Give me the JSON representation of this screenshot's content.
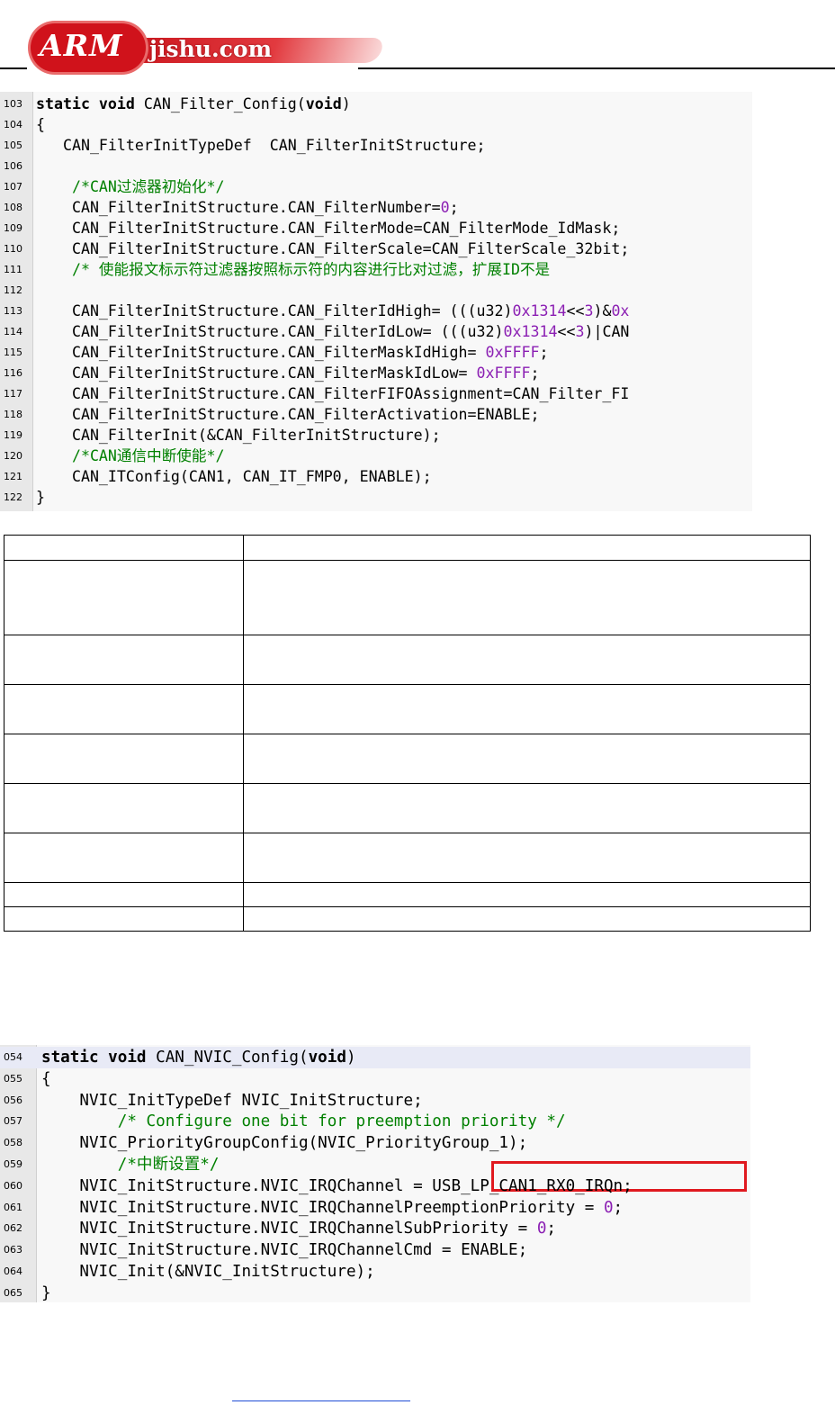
{
  "header": {
    "logo_brand": "ARM",
    "logo_site": "jishu.com"
  },
  "code_block_1": {
    "lines": [
      {
        "num": "103",
        "parts": [
          [
            "kw",
            "static void "
          ],
          [
            "p",
            "CAN_Filter_Config("
          ],
          [
            "kw",
            "void"
          ],
          [
            "p",
            ")"
          ]
        ]
      },
      {
        "num": "104",
        "parts": [
          [
            "p",
            "{"
          ]
        ]
      },
      {
        "num": "105",
        "parts": [
          [
            "p",
            "   CAN_FilterInitTypeDef  CAN_FilterInitStructure;"
          ]
        ]
      },
      {
        "num": "106",
        "parts": []
      },
      {
        "num": "107",
        "parts": [
          [
            "cmt",
            "    /*CAN过滤器初始化*/"
          ]
        ]
      },
      {
        "num": "108",
        "parts": [
          [
            "p",
            "    CAN_FilterInitStructure.CAN_FilterNumber="
          ],
          [
            "num",
            "0"
          ],
          [
            "p",
            ";"
          ]
        ]
      },
      {
        "num": "109",
        "parts": [
          [
            "p",
            "    CAN_FilterInitStructure.CAN_FilterMode=CAN_FilterMode_IdMask;"
          ]
        ]
      },
      {
        "num": "110",
        "parts": [
          [
            "p",
            "    CAN_FilterInitStructure.CAN_FilterScale=CAN_FilterScale_32bit;"
          ]
        ]
      },
      {
        "num": "111",
        "parts": [
          [
            "cmt",
            "    /* 使能报文标示符过滤器按照标示符的内容进行比对过滤，扩展ID不是"
          ]
        ]
      },
      {
        "num": "112",
        "parts": []
      },
      {
        "num": "113",
        "parts": [
          [
            "p",
            "    CAN_FilterInitStructure.CAN_FilterIdHigh= ((("
          ],
          [
            "p",
            "u32"
          ],
          [
            "p",
            ")"
          ],
          [
            "num",
            "0x1314"
          ],
          [
            "p",
            "<<"
          ],
          [
            "num",
            "3"
          ],
          [
            "p",
            ")&"
          ],
          [
            "num",
            "0x"
          ]
        ]
      },
      {
        "num": "114",
        "parts": [
          [
            "p",
            "    CAN_FilterInitStructure.CAN_FilterIdLow= ((("
          ],
          [
            "p",
            "u32"
          ],
          [
            "p",
            ")"
          ],
          [
            "num",
            "0x1314"
          ],
          [
            "p",
            "<<"
          ],
          [
            "num",
            "3"
          ],
          [
            "p",
            ")|CAN"
          ]
        ]
      },
      {
        "num": "115",
        "parts": [
          [
            "p",
            "    CAN_FilterInitStructure.CAN_FilterMaskIdHigh= "
          ],
          [
            "num",
            "0xFFFF"
          ],
          [
            "p",
            ";"
          ]
        ]
      },
      {
        "num": "116",
        "parts": [
          [
            "p",
            "    CAN_FilterInitStructure.CAN_FilterMaskIdLow= "
          ],
          [
            "num",
            "0xFFFF"
          ],
          [
            "p",
            ";"
          ]
        ]
      },
      {
        "num": "117",
        "parts": [
          [
            "p",
            "    CAN_FilterInitStructure.CAN_FilterFIFOAssignment=CAN_Filter_FI"
          ]
        ]
      },
      {
        "num": "118",
        "parts": [
          [
            "p",
            "    CAN_FilterInitStructure.CAN_FilterActivation=ENABLE;"
          ]
        ]
      },
      {
        "num": "119",
        "parts": [
          [
            "p",
            "    CAN_FilterInit(&CAN_FilterInitStructure);"
          ]
        ]
      },
      {
        "num": "120",
        "parts": [
          [
            "cmt",
            "    /*CAN通信中断使能*/"
          ]
        ]
      },
      {
        "num": "121",
        "parts": [
          [
            "p",
            "    CAN_ITConfig(CAN1, CAN_IT_FMP0, ENABLE);"
          ]
        ]
      },
      {
        "num": "122",
        "parts": [
          [
            "p",
            "}"
          ]
        ]
      }
    ]
  },
  "code_block_2": {
    "lines": [
      {
        "num": "054",
        "parts": [
          [
            "kw",
            "static void "
          ],
          [
            "p",
            "CAN_NVIC_Config("
          ],
          [
            "kw",
            "void"
          ],
          [
            "p",
            ")"
          ]
        ]
      },
      {
        "num": "055",
        "parts": [
          [
            "p",
            "{"
          ]
        ]
      },
      {
        "num": "056",
        "parts": [
          [
            "p",
            "    NVIC_InitTypeDef NVIC_InitStructure;"
          ]
        ]
      },
      {
        "num": "057",
        "parts": [
          [
            "cmt",
            "        /* Configure one bit for preemption priority */"
          ]
        ]
      },
      {
        "num": "058",
        "parts": [
          [
            "p",
            "    NVIC_PriorityGroupConfig(NVIC_PriorityGroup_1);"
          ]
        ]
      },
      {
        "num": "059",
        "parts": [
          [
            "cmt",
            "        /*中断设置*/"
          ]
        ]
      },
      {
        "num": "060",
        "parts": [
          [
            "p",
            "    NVIC_InitStructure.NVIC_IRQChannel = USB_LP_CAN1_RX0_IRQn;"
          ]
        ]
      },
      {
        "num": "061",
        "parts": [
          [
            "p",
            "    NVIC_InitStructure.NVIC_IRQChannelPreemptionPriority = "
          ],
          [
            "num",
            "0"
          ],
          [
            "p",
            ";"
          ]
        ]
      },
      {
        "num": "062",
        "parts": [
          [
            "p",
            "    NVIC_InitStructure.NVIC_IRQChannelSubPriority = "
          ],
          [
            "num",
            "0"
          ],
          [
            "p",
            ";"
          ]
        ]
      },
      {
        "num": "063",
        "parts": [
          [
            "p",
            "    NVIC_InitStructure.NVIC_IRQChannelCmd = ENABLE;"
          ]
        ]
      },
      {
        "num": "064",
        "parts": [
          [
            "p",
            "    NVIC_Init(&NVIC_InitStructure);"
          ]
        ]
      },
      {
        "num": "065",
        "parts": [
          [
            "p",
            "}"
          ]
        ]
      }
    ]
  },
  "table": {
    "rows": [
      [
        "",
        ""
      ],
      [
        "",
        ""
      ],
      [
        "",
        ""
      ],
      [
        "",
        ""
      ],
      [
        "",
        ""
      ],
      [
        "",
        ""
      ],
      [
        "",
        ""
      ],
      [
        "",
        ""
      ],
      [
        "",
        ""
      ]
    ]
  },
  "colors": {
    "keyword": "#000000",
    "number": "#8b1fb3",
    "comment": "#008000",
    "highlight_box": "#e0191f",
    "link_underline": "#1f4dd6"
  }
}
